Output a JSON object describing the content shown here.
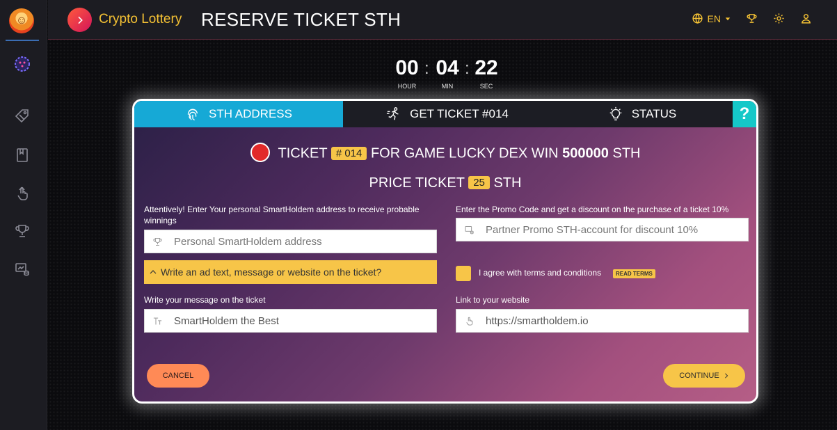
{
  "header": {
    "brand_name": "Crypto Lottery",
    "page_title": "RESERVE TICKET STH",
    "language": "EN"
  },
  "timer": {
    "hours": "00",
    "minutes": "04",
    "seconds": "22",
    "hour_label": "HOUR",
    "min_label": "MIN",
    "sec_label": "SEC"
  },
  "tabs": [
    {
      "label": "STH ADDRESS",
      "icon": "fingerprint-icon",
      "active": true
    },
    {
      "label": "GET TICKET #014",
      "icon": "runner-icon",
      "active": false
    },
    {
      "label": "STATUS",
      "icon": "lightbulb-icon",
      "active": false
    }
  ],
  "help_label": "?",
  "ticket": {
    "prefix": "TICKET",
    "number": "# 014",
    "game_text": "FOR GAME LUCKY DEX WIN",
    "win_amount": "500000",
    "currency": "STH",
    "price_label": "PRICE TICKET",
    "price": "25",
    "price_currency": "STH"
  },
  "form": {
    "address_label": "Attentively! Enter Your personal SmartHoldem address to receive probable winnings",
    "address_placeholder": "Personal SmartHoldem address",
    "promo_label": "Enter the Promo Code and get a discount on the purchase of a ticket 10%",
    "promo_placeholder": "Partner Promo STH-account for discount 10%",
    "ad_toggle": "Write an ad text, message or website on the ticket?",
    "agree_text": "I agree with terms and conditions",
    "read_terms": "READ TERMS",
    "message_label": "Write your message on the ticket",
    "message_value": "SmartHoldem the Best",
    "website_label": "Link to your website",
    "website_value": "https://smartholdem.io"
  },
  "buttons": {
    "cancel": "CANCEL",
    "continue": "CONTINUE"
  },
  "colors": {
    "accent_yellow": "#f7c548",
    "tab_active": "#16a9d6",
    "help_teal": "#15c8c8",
    "cancel_orange": "#ff8a56"
  }
}
